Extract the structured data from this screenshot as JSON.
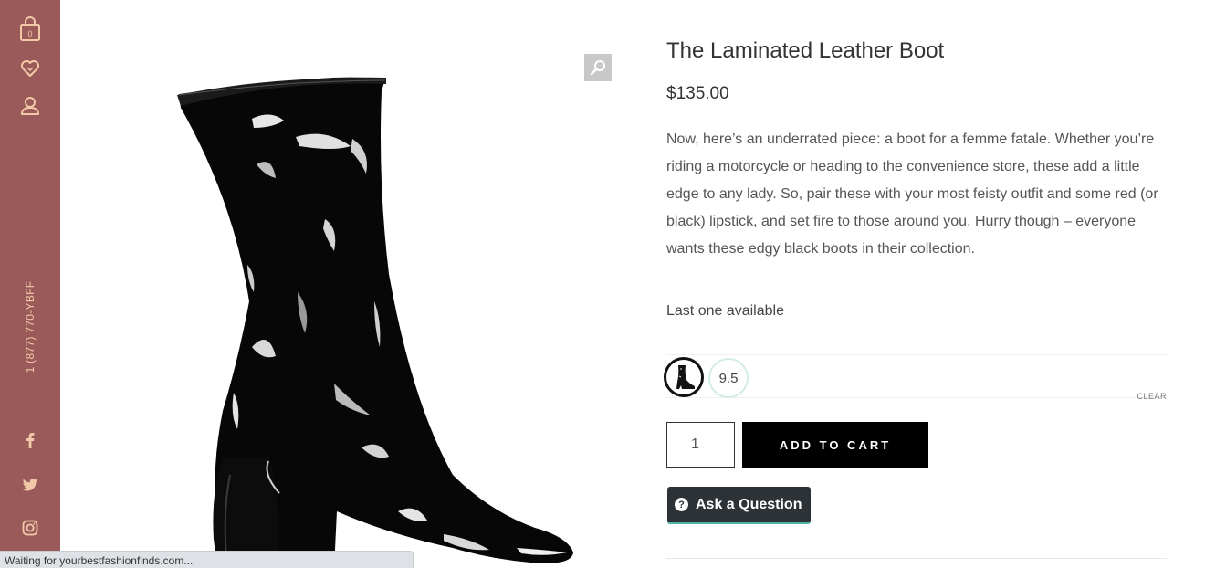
{
  "sidebar": {
    "cart_count": "0",
    "phone": "1 (877) 770-YBFF",
    "accent_color": "#9a5a59",
    "icon_color": "#f2c9a8"
  },
  "product": {
    "title": "The Laminated Leather Boot",
    "price": "$135.00",
    "description": "Now, here’s an underrated piece: a boot for a femme fatale. Whether you’re riding a motorcycle or heading to the convenience store, these add a little edge to any lady. So, pair these with your most feisty outfit and some red (or black) lipstick, and set fire to those around you. Hurry though – everyone wants these edgy black boots in their collection.",
    "stock": "Last one available",
    "size": "9.5",
    "clear_label": "CLEAR",
    "quantity": "1",
    "add_to_cart": "ADD TO CART",
    "ask_question": "Ask a Question"
  },
  "status_bar": {
    "text": "Waiting for yourbestfashionfinds.com..."
  }
}
